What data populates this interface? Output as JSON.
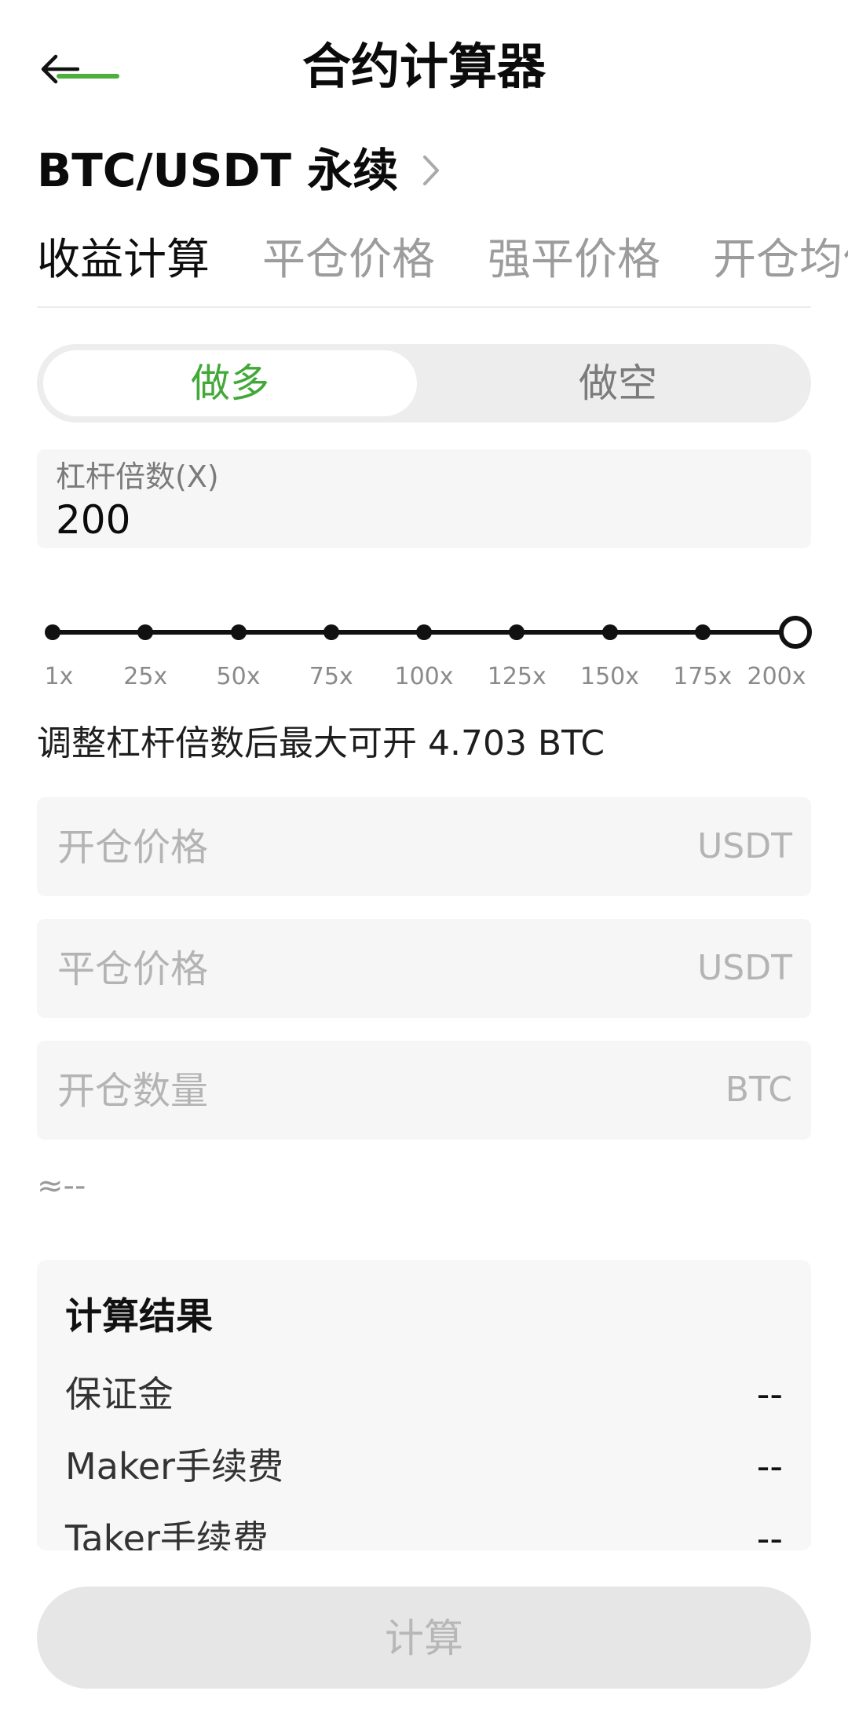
{
  "header": {
    "title": "合约计算器"
  },
  "pair": {
    "label": "BTC/USDT 永续"
  },
  "tabs": [
    {
      "label": "收益计算",
      "active": true
    },
    {
      "label": "平仓价格",
      "active": false
    },
    {
      "label": "强平价格",
      "active": false
    },
    {
      "label": "开仓均价",
      "active": false
    }
  ],
  "side_toggle": {
    "long_label": "做多",
    "short_label": "做空",
    "selected": "做多"
  },
  "leverage": {
    "label": "杠杆倍数(X)",
    "value": "200",
    "slider_marks": [
      "1x",
      "25x",
      "50x",
      "75x",
      "100x",
      "125x",
      "150x",
      "175x",
      "200x"
    ],
    "selected_mark": "200x",
    "max_open_text": "调整杠杆倍数后最大可开 4.703 BTC"
  },
  "inputs": {
    "open_price": {
      "placeholder": "开仓价格",
      "unit": "USDT"
    },
    "close_price": {
      "placeholder": "平仓价格",
      "unit": "USDT"
    },
    "open_amount": {
      "placeholder": "开仓数量",
      "unit": "BTC"
    }
  },
  "approx_text": "≈--",
  "result": {
    "title": "计算结果",
    "rows": [
      {
        "label": "保证金",
        "value": "--"
      },
      {
        "label": "Maker手续费",
        "value": "--"
      },
      {
        "label": "Taker手续费",
        "value": "--"
      }
    ]
  },
  "calc_button": {
    "label": "计算"
  },
  "colors": {
    "accent": "#4caf3e",
    "button_disabled_bg": "#e6e6e6",
    "input_bg": "#f6f6f6"
  }
}
